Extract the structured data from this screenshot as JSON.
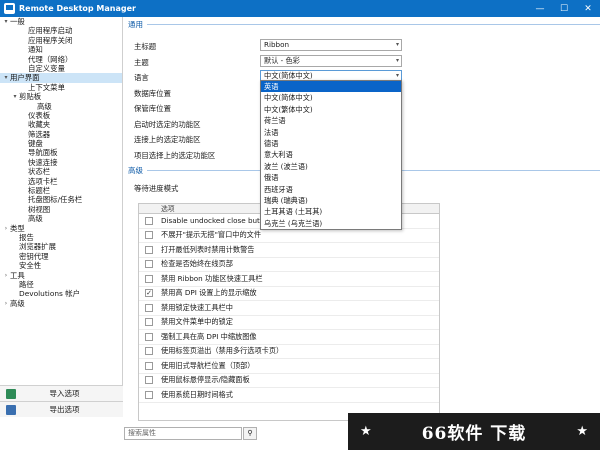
{
  "window": {
    "title": "Remote Desktop Manager",
    "min": "—",
    "max": "☐",
    "close": "✕"
  },
  "tree": [
    {
      "label": "一般",
      "level": 0,
      "arrow": "▾"
    },
    {
      "label": "应用程序启动",
      "level": 2,
      "arrow": ""
    },
    {
      "label": "应用程序关闭",
      "level": 2,
      "arrow": ""
    },
    {
      "label": "通知",
      "level": 2,
      "arrow": ""
    },
    {
      "label": "代理（网络）",
      "level": 2,
      "arrow": ""
    },
    {
      "label": "自定义变量",
      "level": 2,
      "arrow": ""
    },
    {
      "label": "用户界面",
      "level": 0,
      "arrow": "▾",
      "selected": true
    },
    {
      "label": "上下文菜单",
      "level": 2,
      "arrow": ""
    },
    {
      "label": "剪贴板",
      "level": 1,
      "arrow": "▾"
    },
    {
      "label": "高级",
      "level": 3,
      "arrow": ""
    },
    {
      "label": "仪表板",
      "level": 2,
      "arrow": ""
    },
    {
      "label": "收藏夹",
      "level": 2,
      "arrow": ""
    },
    {
      "label": "筛选器",
      "level": 2,
      "arrow": ""
    },
    {
      "label": "键盘",
      "level": 2,
      "arrow": ""
    },
    {
      "label": "导航面板",
      "level": 2,
      "arrow": ""
    },
    {
      "label": "快速连接",
      "level": 2,
      "arrow": ""
    },
    {
      "label": "状态栏",
      "level": 2,
      "arrow": ""
    },
    {
      "label": "选项卡栏",
      "level": 2,
      "arrow": ""
    },
    {
      "label": "标题栏",
      "level": 2,
      "arrow": ""
    },
    {
      "label": "托盘图标/任务栏",
      "level": 2,
      "arrow": ""
    },
    {
      "label": "树视图",
      "level": 2,
      "arrow": ""
    },
    {
      "label": "高级",
      "level": 2,
      "arrow": ""
    },
    {
      "label": "类型",
      "level": 0,
      "arrow": "›"
    },
    {
      "label": "报告",
      "level": 1,
      "arrow": ""
    },
    {
      "label": "浏览器扩展",
      "level": 1,
      "arrow": ""
    },
    {
      "label": "密钥代理",
      "level": 1,
      "arrow": ""
    },
    {
      "label": "安全性",
      "level": 1,
      "arrow": ""
    },
    {
      "label": "工具",
      "level": 0,
      "arrow": "›"
    },
    {
      "label": "路径",
      "level": 1,
      "arrow": ""
    },
    {
      "label": "Devolutions 帐户",
      "level": 1,
      "arrow": ""
    },
    {
      "label": "高级",
      "level": 0,
      "arrow": "›"
    }
  ],
  "side_buttons": {
    "import": "导入选项",
    "export": "导出选项"
  },
  "general": {
    "header": "通用",
    "rows": [
      {
        "label": "主标题",
        "value": "Ribbon"
      },
      {
        "label": "主题",
        "value": "默认 - 色彩"
      },
      {
        "label": "语言",
        "value": "中文(简体中文)"
      },
      {
        "label": "数据库位置",
        "value": ""
      },
      {
        "label": "保管库位置",
        "value": ""
      },
      {
        "label": "启动时选定的功能区",
        "value": ""
      },
      {
        "label": "连接上的选定功能区",
        "value": ""
      },
      {
        "label": "项目选择上的选定功能区",
        "value": ""
      }
    ]
  },
  "language_options": [
    "英语",
    "中文(简体中文)",
    "中文(繁体中文)",
    "荷兰语",
    "法语",
    "德语",
    "意大利语",
    "波兰 (波兰语)",
    "俄语",
    "西班牙语",
    "瑞典 (瑞典语)",
    "土耳其语 (土耳其)",
    "乌克兰 (乌克兰语)"
  ],
  "advanced": {
    "header": "高级",
    "wait_label": "等待进度模式",
    "grid_header": "选项",
    "options": [
      {
        "text": "Disable undocked close button",
        "checked": false
      },
      {
        "text": "不展开\"提示无搭\"窗口中的文件",
        "checked": false
      },
      {
        "text": "打开最低列表时禁用计数警告",
        "checked": false
      },
      {
        "text": "检查是否始终在线页部",
        "checked": false
      },
      {
        "text": "禁用 Ribbon 功能区快速工具栏",
        "checked": false
      },
      {
        "text": "禁用高 DPI 设置上的显示缩放",
        "checked": true
      },
      {
        "text": "禁用锁定快速工具栏中",
        "checked": false
      },
      {
        "text": "禁用文件菜单中的锁定",
        "checked": false
      },
      {
        "text": "强制工具在高 DPI 中缩放图像",
        "checked": false
      },
      {
        "text": "使用标签页溢出（禁用多行选项卡页）",
        "checked": false
      },
      {
        "text": "使用旧式导航栏位置（顶部）",
        "checked": false
      },
      {
        "text": "使用鼠标悬停显示/隐藏面板",
        "checked": false
      },
      {
        "text": "使用系统日期时间格式",
        "checked": false
      }
    ],
    "check_mark": "✓"
  },
  "search": {
    "placeholder": "搜索属性",
    "button_icon": "⚲"
  },
  "watermark": {
    "text": "66软件 下载",
    "star": "★"
  },
  "colors": {
    "accent": "#0d70c5",
    "selection": "#cce4f7",
    "highlight": "#0a64c8"
  }
}
